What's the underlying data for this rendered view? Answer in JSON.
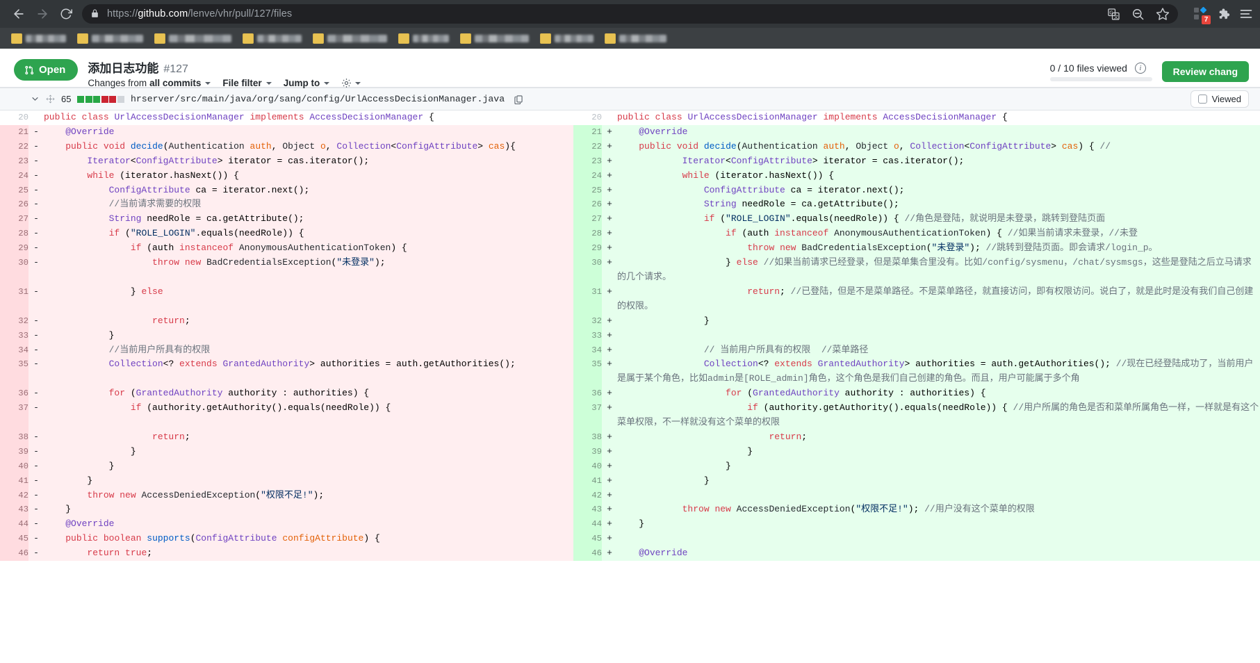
{
  "browser": {
    "back_icon": "back-arrow-icon",
    "forward_icon": "forward-arrow-icon",
    "reload_icon": "reload-icon",
    "lock_icon": "lock-icon",
    "url_scheme": "https://",
    "url_host": "github.com",
    "url_path": "/lenve/vhr/pull/127/files",
    "omni_icons": [
      "translate-icon",
      "zoom-out-icon",
      "bookmark-star-icon"
    ],
    "extension_icons": [
      "extensions-grid-icon",
      "puzzle-piece-icon",
      "chrome-menu-icon"
    ],
    "extension_badge": "7",
    "bookmarks_count": 9
  },
  "pr": {
    "state_label": "Open",
    "state_icon": "pull-request-icon",
    "state_color": "#2ea44f",
    "title": "添加日志功能",
    "number": "#127",
    "changes_from_prefix": "Changes from",
    "changes_from_value": "all commits",
    "file_filter_label": "File filter",
    "jump_to_label": "Jump to",
    "gear_icon": "gear-icon",
    "files_viewed_text": "0 / 10 files viewed",
    "info_icon": "info-icon",
    "review_button_label": "Review chang",
    "progress_percent": 0
  },
  "file": {
    "chevron_icon": "chevron-down-icon",
    "drag_icon": "drag-handle-icon",
    "change_count": "65",
    "diffstat": [
      "add",
      "add",
      "add",
      "del",
      "del",
      "neu"
    ],
    "path": "hrserver/src/main/java/org/sang/config/UrlAccessDecisionManager.java",
    "copy_icon": "copy-icon",
    "viewed_label": "Viewed",
    "viewed_checked": false
  },
  "diff": {
    "rows": [
      {
        "type": "ctx",
        "left_num": "20",
        "left_sign": "",
        "left_html": "<span class=\"k\">public</span> <span class=\"k\">class</span> <span class=\"t\">UrlAccessDecisionManager</span> <span class=\"k\">implements</span> <span class=\"t\">AccessDecisionManager</span> {",
        "right_num": "20",
        "right_sign": "",
        "right_html": "<span class=\"k\">public</span> <span class=\"k\">class</span> <span class=\"t\">UrlAccessDecisionManager</span> <span class=\"k\">implements</span> <span class=\"t\">AccessDecisionManager</span> {"
      },
      {
        "type": "chg",
        "left_num": "21",
        "left_sign": "-",
        "left_html": "    <span class=\"t\">@Override</span>",
        "right_num": "21",
        "right_sign": "+",
        "right_html": "    <span class=\"t\">@Override</span>"
      },
      {
        "type": "chg",
        "left_num": "22",
        "left_sign": "-",
        "left_html": "    <span class=\"k\">public</span> <span class=\"k\">void</span> <span class=\"fn\">decide</span>(<span class=\"p\">Authentication</span> <span class=\"e\">auth</span>, <span class=\"p\">Object</span> <span class=\"e\">o</span>, <span class=\"t\">Collection</span>&lt;<span class=\"t\">ConfigAttribute</span>&gt; <span class=\"e\">cas</span>){",
        "right_num": "22",
        "right_sign": "+",
        "right_html": "    <span class=\"k\">public</span> <span class=\"k\">void</span> <span class=\"fn\">decide</span>(<span class=\"p\">Authentication</span> <span class=\"e\">auth</span>, <span class=\"p\">Object</span> <span class=\"e\">o</span>, <span class=\"t\">Collection</span>&lt;<span class=\"t\">ConfigAttribute</span>&gt; <span class=\"e\">cas</span>) { <span class=\"cm\">//</span>"
      },
      {
        "type": "chg",
        "left_num": "23",
        "left_sign": "-",
        "left_html": "        <span class=\"t\">Iterator</span>&lt;<span class=\"t\">ConfigAttribute</span>&gt; iterator = cas.iterator();",
        "right_num": "23",
        "right_sign": "+",
        "right_html": "            <span class=\"t\">Iterator</span>&lt;<span class=\"t\">ConfigAttribute</span>&gt; iterator = cas.iterator();"
      },
      {
        "type": "chg",
        "left_num": "24",
        "left_sign": "-",
        "left_html": "        <span class=\"k\">while</span> (iterator.hasNext()) {",
        "right_num": "24",
        "right_sign": "+",
        "right_html": "            <span class=\"k\">while</span> (iterator.hasNext()) {"
      },
      {
        "type": "chg",
        "left_num": "25",
        "left_sign": "-",
        "left_html": "            <span class=\"t\">ConfigAttribute</span> ca = iterator.next();",
        "right_num": "25",
        "right_sign": "+",
        "right_html": "                <span class=\"t\">ConfigAttribute</span> ca = iterator.next();"
      },
      {
        "type": "chg",
        "left_num": "26",
        "left_sign": "-",
        "left_html": "            <span class=\"cm\">//当前请求需要的权限</span>",
        "right_num": "26",
        "right_sign": "+",
        "right_html": "                <span class=\"t\">String</span> needRole = ca.getAttribute();"
      },
      {
        "type": "chg",
        "left_num": "27",
        "left_sign": "-",
        "left_html": "            <span class=\"t\">String</span> needRole = ca.getAttribute();",
        "right_num": "27",
        "right_sign": "+",
        "right_html": "                <span class=\"k\">if</span> (<span class=\"s\">\"ROLE_LOGIN\"</span>.equals(needRole)) { <span class=\"cm\">//角色是登陆，就说明是未登录，跳转到登陆页面</span>"
      },
      {
        "type": "chg",
        "left_num": "28",
        "left_sign": "-",
        "left_html": "            <span class=\"k\">if</span> (<span class=\"s\">\"ROLE_LOGIN\"</span>.equals(needRole)) {",
        "right_num": "28",
        "right_sign": "+",
        "right_html": "                    <span class=\"k\">if</span> (auth <span class=\"k\">instanceof</span> <span class=\"p\">AnonymousAuthenticationToken</span>) { <span class=\"cm\">//如果当前请求未登录，//未登</span>"
      },
      {
        "type": "chg",
        "left_num": "29",
        "left_sign": "-",
        "left_html": "                <span class=\"k\">if</span> (auth <span class=\"k\">instanceof</span> <span class=\"p\">AnonymousAuthenticationToken</span>) {",
        "right_num": "29",
        "right_sign": "+",
        "right_html": "                        <span class=\"k\">throw</span> <span class=\"k\">new</span> <span class=\"p\">BadCredentialsException</span>(<span class=\"s\">\"未登录\"</span>); <span class=\"cm\">//跳转到登陆页面。即会请求/login_p。</span>"
      },
      {
        "type": "chg",
        "left_num": "30",
        "left_sign": "-",
        "left_html": "                    <span class=\"k\">throw</span> <span class=\"k\">new</span> <span class=\"p\">BadCredentialsException</span>(<span class=\"s\">\"未登录\"</span>);",
        "right_num": "30",
        "right_sign": "+",
        "right_html": "                    } <span class=\"k\">else</span> <span class=\"cm\">//如果当前请求已经登录，但是菜单集合里没有。比如/config/sysmenu，/chat/sysmsgs，这些是登陆之后立马请求的几个请求。</span>"
      },
      {
        "type": "chg",
        "left_num": "31",
        "left_sign": "-",
        "left_html": "                } <span class=\"k\">else</span>",
        "right_num": "31",
        "right_sign": "+",
        "right_html": "                        <span class=\"k\">return</span>; <span class=\"cm\">//已登陆，但是不是菜单路径。不是菜单路径，就直接访问，即有权限访问。说白了，就是此时是没有我们自己创建的权限。</span>"
      },
      {
        "type": "chg",
        "left_num": "32",
        "left_sign": "-",
        "left_html": "                    <span class=\"k\">return</span>;",
        "right_num": "32",
        "right_sign": "+",
        "right_html": "                }"
      },
      {
        "type": "chg",
        "left_num": "33",
        "left_sign": "-",
        "left_html": "            }",
        "right_num": "33",
        "right_sign": "+",
        "right_html": ""
      },
      {
        "type": "chg",
        "left_num": "34",
        "left_sign": "-",
        "left_html": "            <span class=\"cm\">//当前用户所具有的权限</span>",
        "right_num": "34",
        "right_sign": "+",
        "right_html": "                <span class=\"cm\">// 当前用户所具有的权限  //菜单路径</span>"
      },
      {
        "type": "chg",
        "left_num": "35",
        "left_sign": "-",
        "left_html": "            <span class=\"t\">Collection</span>&lt;? <span class=\"k\">extends</span> <span class=\"t\">GrantedAuthority</span>&gt; authorities = auth.getAuthorities();",
        "right_num": "35",
        "right_sign": "+",
        "right_html": "                <span class=\"t\">Collection</span>&lt;? <span class=\"k\">extends</span> <span class=\"t\">GrantedAuthority</span>&gt; authorities = auth.getAuthorities(); <span class=\"cm\">//现在已经登陆成功了，当前用户是属于某个角色，比如admin是[ROLE_admin]角色，这个角色是我们自己创建的角色。而且，用户可能属于多个角</span>"
      },
      {
        "type": "chg",
        "left_num": "36",
        "left_sign": "-",
        "left_html": "            <span class=\"k\">for</span> (<span class=\"t\">GrantedAuthority</span> authority : authorities) {",
        "right_num": "36",
        "right_sign": "+",
        "right_html": "                    <span class=\"k\">for</span> (<span class=\"t\">GrantedAuthority</span> authority : authorities) {"
      },
      {
        "type": "chg",
        "left_num": "37",
        "left_sign": "-",
        "left_html": "                <span class=\"k\">if</span> (authority.getAuthority().equals(needRole)) {",
        "right_num": "37",
        "right_sign": "+",
        "right_html": "                        <span class=\"k\">if</span> (authority.getAuthority().equals(needRole)) { <span class=\"cm\">//用户所属的角色是否和菜单所属角色一样，一样就是有这个菜单权限，不一样就没有这个菜单的权限</span>"
      },
      {
        "type": "chg",
        "left_num": "38",
        "left_sign": "-",
        "left_html": "                    <span class=\"k\">return</span>;",
        "right_num": "38",
        "right_sign": "+",
        "right_html": "                            <span class=\"k\">return</span>;"
      },
      {
        "type": "chg",
        "left_num": "39",
        "left_sign": "-",
        "left_html": "                }",
        "right_num": "39",
        "right_sign": "+",
        "right_html": "                        }"
      },
      {
        "type": "chg",
        "left_num": "40",
        "left_sign": "-",
        "left_html": "            }",
        "right_num": "40",
        "right_sign": "+",
        "right_html": "                    }"
      },
      {
        "type": "chg",
        "left_num": "41",
        "left_sign": "-",
        "left_html": "        }",
        "right_num": "41",
        "right_sign": "+",
        "right_html": "                }"
      },
      {
        "type": "chg",
        "left_num": "42",
        "left_sign": "-",
        "left_html": "        <span class=\"k\">throw</span> <span class=\"k\">new</span> <span class=\"p\">AccessDeniedException</span>(<span class=\"s\">\"权限不足!\"</span>);",
        "right_num": "42",
        "right_sign": "+",
        "right_html": ""
      },
      {
        "type": "chg",
        "left_num": "43",
        "left_sign": "-",
        "left_html": "    }",
        "right_num": "43",
        "right_sign": "+",
        "right_html": "            <span class=\"k\">throw</span> <span class=\"k\">new</span> <span class=\"p\">AccessDeniedException</span>(<span class=\"s\">\"权限不足!\"</span>); <span class=\"cm\">//用户没有这个菜单的权限</span>"
      },
      {
        "type": "chg",
        "left_num": "44",
        "left_sign": "-",
        "left_html": "    <span class=\"t\">@Override</span>",
        "right_num": "44",
        "right_sign": "+",
        "right_html": "    }"
      },
      {
        "type": "chg",
        "left_num": "45",
        "left_sign": "-",
        "left_html": "    <span class=\"k\">public</span> <span class=\"k\">boolean</span> <span class=\"fn\">supports</span>(<span class=\"t\">ConfigAttribute</span> <span class=\"e\">configAttribute</span>) {",
        "right_num": "45",
        "right_sign": "+",
        "right_html": ""
      },
      {
        "type": "chg",
        "left_num": "46",
        "left_sign": "-",
        "left_html": "        <span class=\"k\">return</span> <span class=\"k\">true</span>;",
        "right_num": "46",
        "right_sign": "+",
        "right_html": "    <span class=\"t\">@Override</span>"
      }
    ]
  }
}
